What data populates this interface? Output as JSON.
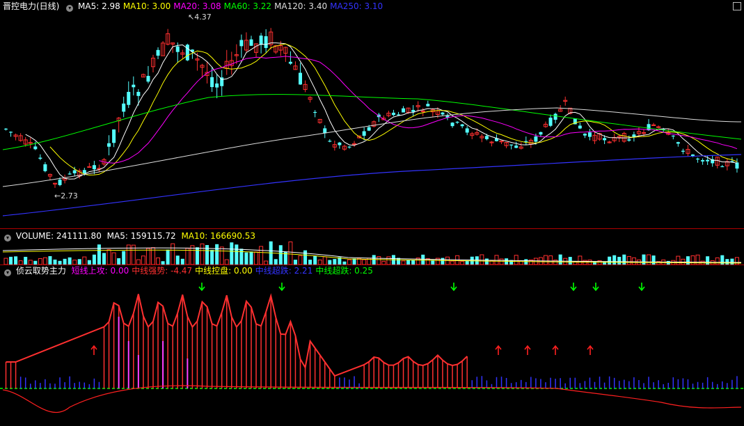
{
  "price_panel": {
    "title": "晋控电力(日线)",
    "ma": [
      {
        "label": "MA5: 2.98",
        "color": "#ffffff"
      },
      {
        "label": "MA10: 3.00",
        "color": "#ffff00"
      },
      {
        "label": "MA20: 3.08",
        "color": "#ff00ff"
      },
      {
        "label": "MA60: 3.22",
        "color": "#00ff00"
      },
      {
        "label": "MA120: 3.40",
        "color": "#dddddd"
      },
      {
        "label": "MA250: 3.10",
        "color": "#3333ff"
      }
    ],
    "high_label": "4.37",
    "low_label": "2.73"
  },
  "volume_panel": {
    "title": "VOLUME: 241111.80",
    "ma5": "MA5: 159115.72",
    "ma10": "MA10: 166690.53"
  },
  "indicator_panel": {
    "title": "侦云取势主力",
    "items": [
      {
        "label": "短线上攻: 0.00",
        "color": "#ff00ff"
      },
      {
        "label": "中线强势: -4.47",
        "color": "#ff3030"
      },
      {
        "label": "中线控盘: 0.00",
        "color": "#ffff00"
      },
      {
        "label": "中线超跌: 2.21",
        "color": "#3333ff"
      },
      {
        "label": "中线超跌: 0.25",
        "color": "#00ff00"
      }
    ]
  },
  "colors": {
    "up": "#ff3030",
    "down": "#54ffff",
    "separator": "#b00000",
    "ma5": "#ffffff",
    "ma10": "#ffff00",
    "ma20": "#ff00ff",
    "ma60": "#00ff00",
    "ma120": "#dddddd",
    "ma250": "#3333ff"
  }
}
